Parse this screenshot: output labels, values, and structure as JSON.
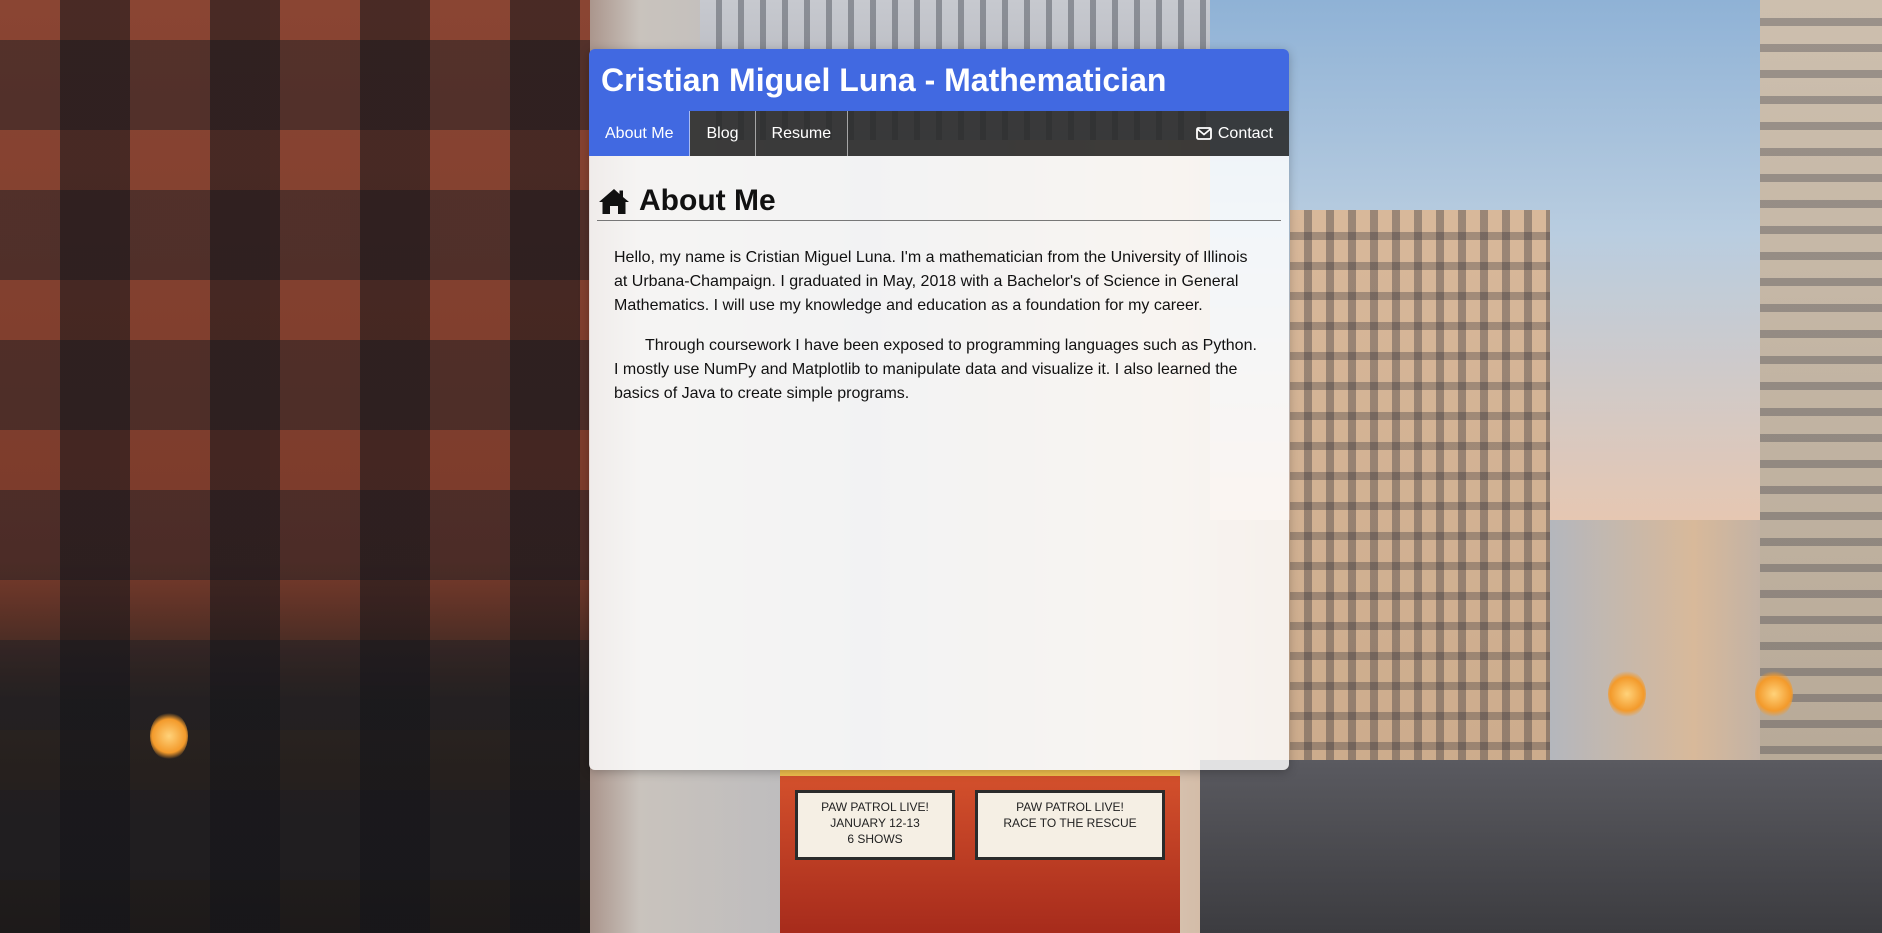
{
  "header": {
    "title": "Cristian Miguel Luna - Mathematician"
  },
  "nav": {
    "items": [
      {
        "label": "About Me",
        "active": true
      },
      {
        "label": "Blog",
        "active": false
      },
      {
        "label": "Resume",
        "active": false
      }
    ],
    "contact": {
      "label": "Contact",
      "icon": "envelope-icon"
    }
  },
  "page": {
    "title": "About Me",
    "title_icon": "home-icon",
    "paragraphs": [
      "Hello, my name is Cristian Miguel Luna. I'm a mathematician from the University of Illinois at Urbana-Champaign. I graduated in May, 2018 with a Bachelor's of Science in General Mathematics. I will use my knowledge and education as a foundation for my career.",
      "Through coursework I have been exposed to programming languages such as Python. I mostly use NumPy and Matplotlib to manipulate data and visualize it. I also learned the basics of Java to create simple programs."
    ]
  },
  "background": {
    "marquee_left": [
      "PAW PATROL LIVE!",
      "JANUARY 12-13",
      "6 SHOWS"
    ],
    "marquee_right": [
      "PAW PATROL LIVE!",
      "RACE TO THE RESCUE"
    ]
  },
  "colors": {
    "accent": "#4169e1",
    "nav_bg": "#2d2d2d",
    "content_bg": "#ffffff"
  }
}
